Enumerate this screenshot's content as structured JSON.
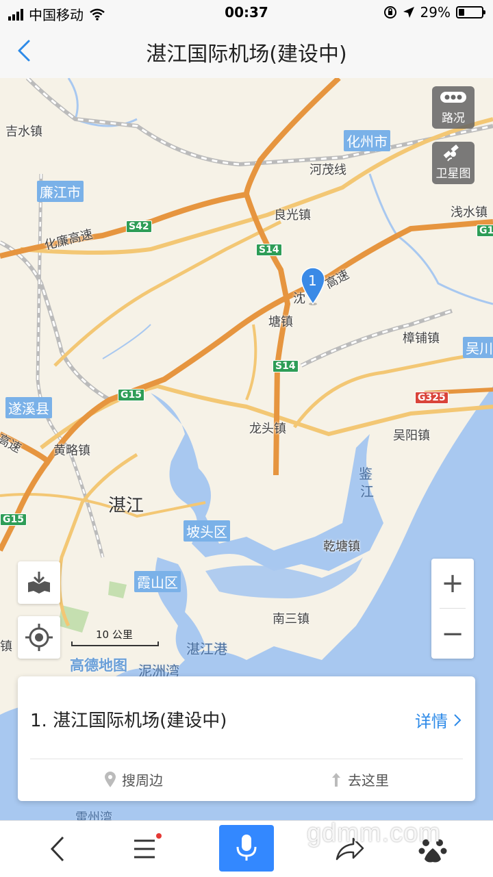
{
  "status_bar": {
    "carrier": "中国移动",
    "time": "00:37",
    "battery": "29%"
  },
  "nav": {
    "title": "湛江国际机场(建设中)"
  },
  "map": {
    "buttons": {
      "traffic": "路况",
      "satellite": "卫星图"
    },
    "marker_number": "1",
    "scale": "10 公里",
    "logo": "高德地图",
    "labels": {
      "jishui": "吉水镇",
      "huazhou": "化州市",
      "hemao": "河茂线",
      "lianjiang": "廉江市",
      "liangguang": "良光镇",
      "qianshui": "浅水镇",
      "hualian": "化廉高速",
      "shen": "沈",
      "gaosu": "高速",
      "tang": "塘镇",
      "zhangpu": "樟铺镇",
      "wuchuan": "吴川",
      "suixi": "遂溪县",
      "longtou": "龙头镇",
      "wuyang": "吴阳镇",
      "gao": "高速",
      "huanglue": "黄略镇",
      "jian": "鉴",
      "jiang2": "江",
      "zhanjiang": "湛江",
      "potou": "坡头区",
      "qiantang": "乾塘镇",
      "xiashan": "霞山区",
      "nansan": "南三镇",
      "zhen": "镇",
      "zhanjianggang": "湛江港",
      "nizhouwan": "泥洲湾",
      "leizhouwan": "雷州湾"
    },
    "shields": {
      "s42": "S42",
      "s14a": "S14",
      "s14b": "S14",
      "g15a": "G15",
      "g15b": "G15",
      "g325": "G325",
      "g1": "G1"
    }
  },
  "result": {
    "title": "1. 湛江国际机场(建设中)",
    "detail": "详情",
    "nearby": "搜周边",
    "go_here": "去这里"
  },
  "watermark": "gdmm.com"
}
